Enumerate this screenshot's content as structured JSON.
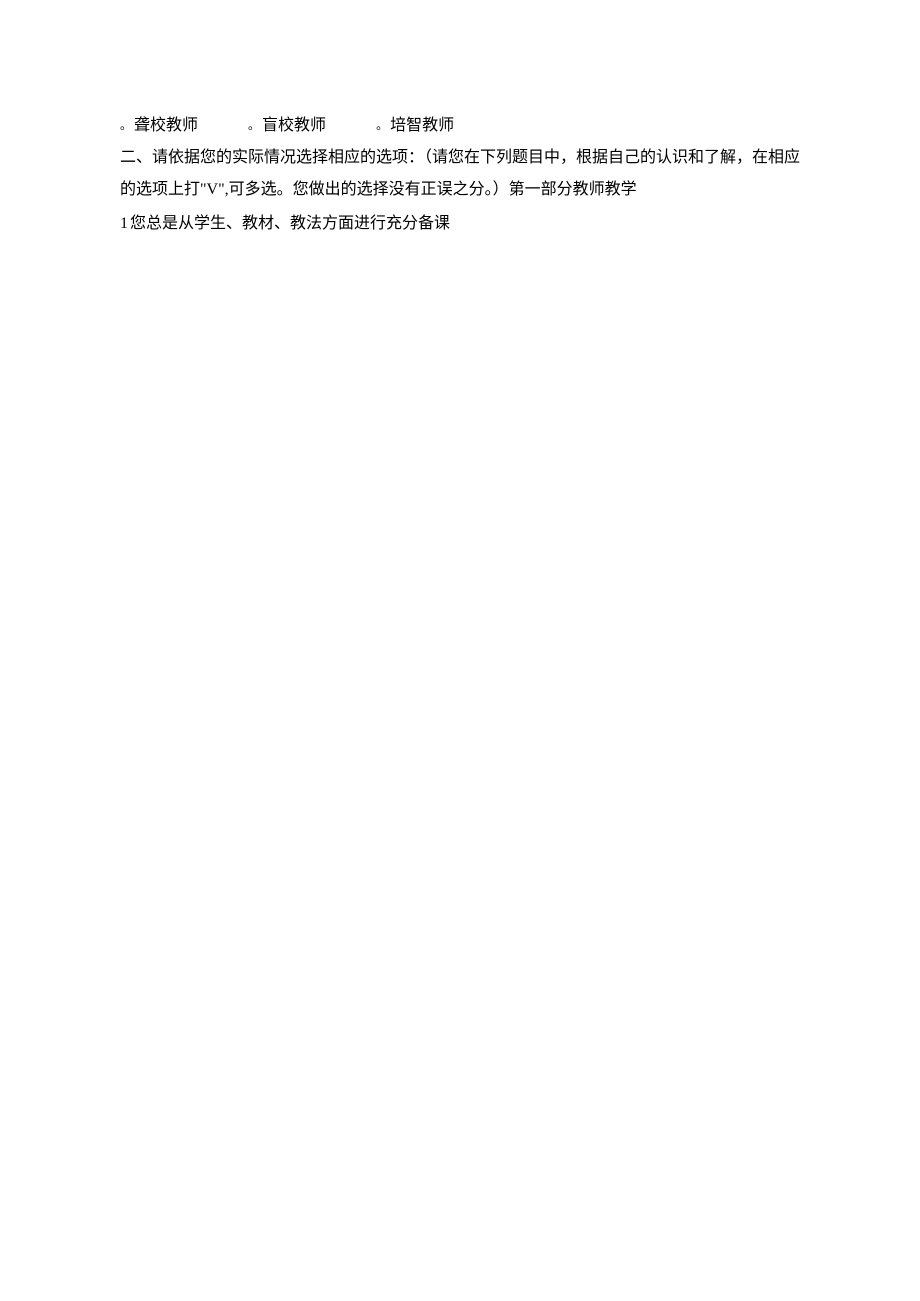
{
  "options_row": {
    "bullet": "。",
    "option1": "聋校教师",
    "option2": "盲校教师",
    "option3": "培智教师"
  },
  "instruction": {
    "prefix": "二、请依据您的实际情况选择相应的选项：（请您在下列题目中，根据自己的认识和了解，在相应的选项上打\"V\",可多选。您做出的选择没有正误之分。）第一部分教师教学"
  },
  "question1": {
    "number": "1",
    "text": "您总是从学生、教材、教法方面进行充分备课"
  }
}
